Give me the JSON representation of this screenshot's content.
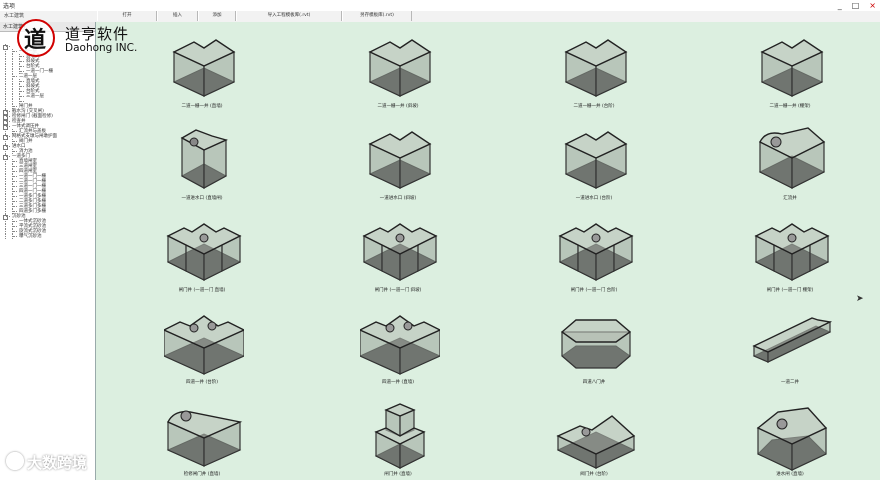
{
  "window": {
    "title": "选项",
    "minimize": "_",
    "maximize": "□",
    "close": "×"
  },
  "menubar": {
    "left_label": "水工建筑",
    "tabs": [
      "打开",
      "插入",
      "添加",
      "导入工程模板库(.rvt)",
      "另存模板库(.rvt)"
    ]
  },
  "sidepanel": {
    "header": "水工建筑▾",
    "tree": [
      {
        "label": "",
        "depth": 0
      },
      {
        "label": "一道一层",
        "depth": 1
      },
      {
        "label": "直墙式",
        "depth": 2
      },
      {
        "label": "斜坡式",
        "depth": 2
      },
      {
        "label": "台阶式",
        "depth": 2
      },
      {
        "label": "一道一门一栅",
        "depth": 2
      },
      {
        "label": "二道一层",
        "depth": 1
      },
      {
        "label": "直墙式",
        "depth": 2
      },
      {
        "label": "斜坡式",
        "depth": 2
      },
      {
        "label": "台阶式",
        "depth": 2
      },
      {
        "label": "三道一层",
        "depth": 2
      },
      {
        "label": "",
        "depth": 2
      },
      {
        "label": "闸门井",
        "depth": 1
      },
      {
        "label": "截水沟 (交叉闸)",
        "depth": 0
      },
      {
        "label": "检修闸门 (截面检修)",
        "depth": 0
      },
      {
        "label": "检查井",
        "depth": 0
      },
      {
        "label": "一体式调压井",
        "depth": 0
      },
      {
        "label": "汇流井与盖板",
        "depth": 1
      },
      {
        "label": "网格式支墩与闸墩护面",
        "depth": 0
      },
      {
        "label": "阀门井",
        "depth": 1
      },
      {
        "label": "进水口",
        "depth": 0
      },
      {
        "label": "消力池",
        "depth": 1
      },
      {
        "label": "一道多门",
        "depth": 0
      },
      {
        "label": "直墙闸室",
        "depth": 1
      },
      {
        "label": "三道闸室",
        "depth": 1
      },
      {
        "label": "四道闸室",
        "depth": 1
      },
      {
        "label": "一道一门一栅",
        "depth": 1
      },
      {
        "label": "二道一门一栅",
        "depth": 1
      },
      {
        "label": "三道一门一栅",
        "depth": 1
      },
      {
        "label": "四道一门一栅",
        "depth": 1
      },
      {
        "label": "一道多门多栅",
        "depth": 1
      },
      {
        "label": "二道多门多栅",
        "depth": 1
      },
      {
        "label": "三道多门多栅",
        "depth": 1
      },
      {
        "label": "四道多门多栅",
        "depth": 1
      },
      {
        "label": "沉砂池",
        "depth": 0
      },
      {
        "label": "一体式沉砂池",
        "depth": 1
      },
      {
        "label": "平流式沉砂池",
        "depth": 1
      },
      {
        "label": "旋流式沉砂池",
        "depth": 1
      },
      {
        "label": "曝气沉砂池",
        "depth": 1
      }
    ]
  },
  "logo": {
    "mark": "道",
    "cn": "道亨软件",
    "en": "Daohong INC."
  },
  "gallery": {
    "items": [
      {
        "caption": "二道一栅一井 (直墙)",
        "shape": "box-notch"
      },
      {
        "caption": "二道一栅一井 (斜坡)",
        "shape": "box-notch"
      },
      {
        "caption": "二道一栅一井 (台阶)",
        "shape": "box-notch"
      },
      {
        "caption": "二道一栅一井 (棚架)",
        "shape": "box-notch"
      },
      {
        "caption": "一道进水口 (直墙闸)",
        "shape": "tower"
      },
      {
        "caption": "一道进水口 (斜坡)",
        "shape": "box-notch"
      },
      {
        "caption": "一道进水口 (台阶)",
        "shape": "box-notch"
      },
      {
        "caption": "汇流井",
        "shape": "box-round"
      },
      {
        "caption": "闸门井 (一道一门 直墙)",
        "shape": "cross"
      },
      {
        "caption": "闸门井 (一道一门 斜坡)",
        "shape": "cross"
      },
      {
        "caption": "闸门井 (一道一门 台阶)",
        "shape": "cross"
      },
      {
        "caption": "闸门井 (一道一门 棚架)",
        "shape": "cross"
      },
      {
        "caption": "四道一井 (台阶)",
        "shape": "cross-wide"
      },
      {
        "caption": "四道一井 (直墙)",
        "shape": "cross-wide"
      },
      {
        "caption": "四道八门井",
        "shape": "octagon"
      },
      {
        "caption": "一道二井",
        "shape": "long"
      },
      {
        "caption": "检修闸门井 (直墙)",
        "shape": "curved"
      },
      {
        "caption": "闸门井 (直墙)",
        "shape": "stack"
      },
      {
        "caption": "阀门井 (台阶)",
        "shape": "flat-notch"
      },
      {
        "caption": "进水闸 (直墙)",
        "shape": "pentagon"
      }
    ]
  },
  "watermark": "大数跨境",
  "colors": {
    "gallery_bg": "#dcefe0",
    "logo_red": "#d10000"
  }
}
